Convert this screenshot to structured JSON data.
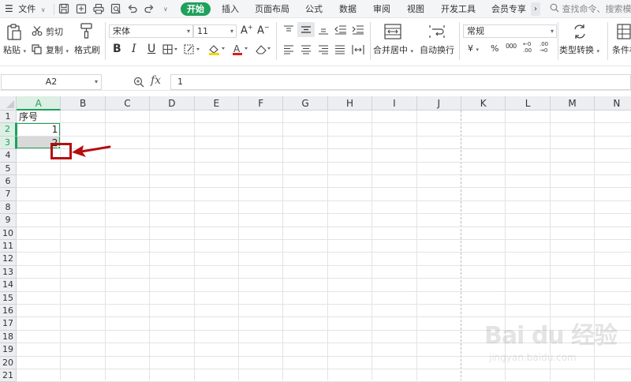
{
  "menubar": {
    "file_label": "文件",
    "tabs": [
      "开始",
      "插入",
      "页面布局",
      "公式",
      "数据",
      "审阅",
      "视图",
      "开发工具",
      "会员专享"
    ],
    "more": "›",
    "search_placeholder": "查找命令、搜索模板"
  },
  "ribbon": {
    "paste": "粘贴",
    "cut": "剪切",
    "copy": "复制",
    "format_painter": "格式刷",
    "font_name": "宋体",
    "font_size": "11",
    "bold": "B",
    "italic": "I",
    "underline": "U",
    "merge_center": "合并居中",
    "wrap_text": "自动换行",
    "number_format": "常规",
    "currency": "¥",
    "percent": "%",
    "thousands": "000",
    "inc_decimal": "←0 .00",
    "dec_decimal": ".00 →0",
    "type_convert": "类型转换",
    "cond_format": "条件格"
  },
  "formula_bar": {
    "name_box": "A2",
    "fx": "fx",
    "value": "1"
  },
  "sheet": {
    "columns": [
      "A",
      "B",
      "C",
      "D",
      "E",
      "F",
      "G",
      "H",
      "I",
      "J",
      "K",
      "L",
      "M",
      "N"
    ],
    "rows": [
      "1",
      "2",
      "3",
      "4",
      "5",
      "6",
      "7",
      "8",
      "9",
      "10",
      "11",
      "12",
      "13",
      "14",
      "15",
      "16",
      "17",
      "18",
      "19",
      "20",
      "21"
    ],
    "cells": {
      "A1": "序号",
      "A2": "1",
      "A3": "2"
    },
    "selected_column": "A",
    "selected_rows": [
      "2",
      "3"
    ]
  },
  "watermark": {
    "brand": "Bai du 经验",
    "site": "jingyan.baidu.com"
  },
  "colors": {
    "accent_green": "#1fa05c",
    "annotation_red": "#b50e0e"
  }
}
